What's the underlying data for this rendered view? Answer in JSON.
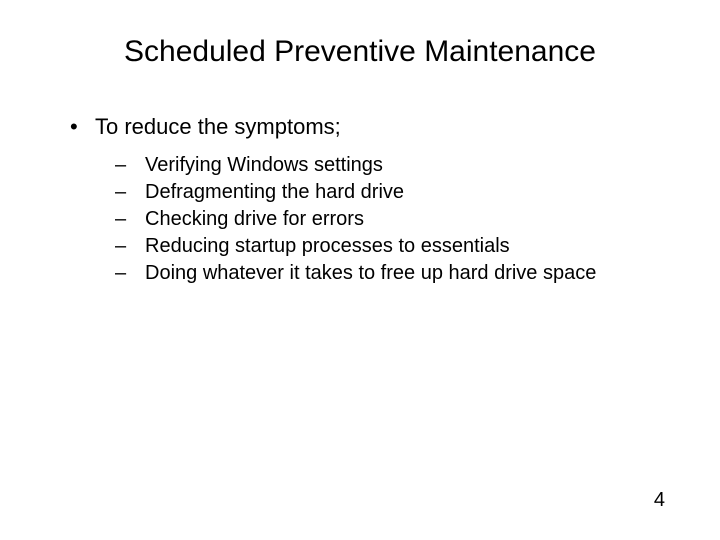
{
  "title": "Scheduled Preventive Maintenance",
  "main_bullet": {
    "marker": "•",
    "text": "To reduce the symptoms;"
  },
  "sub_bullets": [
    {
      "marker": "–",
      "text": "Verifying Windows settings"
    },
    {
      "marker": "–",
      "text": "Defragmenting the hard drive"
    },
    {
      "marker": "–",
      "text": "Checking drive for errors"
    },
    {
      "marker": "–",
      "text": "Reducing startup processes to essentials"
    },
    {
      "marker": "–",
      "text": "Doing whatever it takes to free up hard drive space"
    }
  ],
  "page_number": "4"
}
